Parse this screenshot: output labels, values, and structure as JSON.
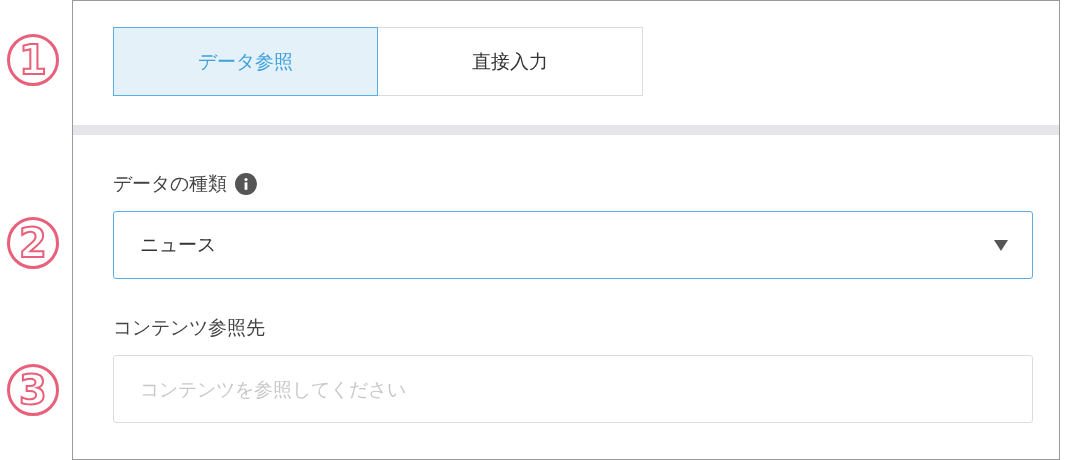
{
  "step_markers": [
    "1",
    "2",
    "3"
  ],
  "mode_tabs": [
    {
      "label": "データ参照",
      "selected": true
    },
    {
      "label": "直接入力",
      "selected": false
    }
  ],
  "data_type": {
    "label": "データの種類",
    "value": "ニュース"
  },
  "content_ref": {
    "label": "コンテンツ参照先",
    "placeholder": "コンテンツを参照してください"
  }
}
